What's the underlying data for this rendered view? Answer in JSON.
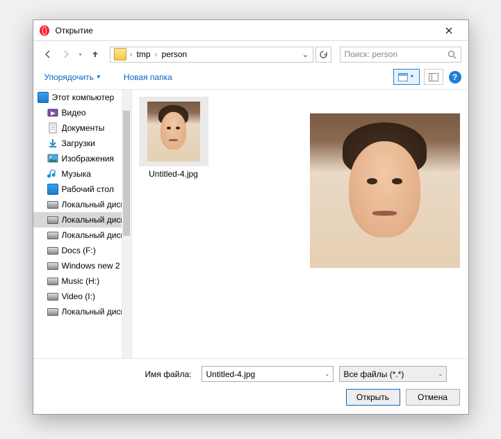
{
  "window": {
    "title": "Открытие"
  },
  "breadcrumb": {
    "seg1": "tmp",
    "seg2": "person"
  },
  "search": {
    "placeholder": "Поиск: person"
  },
  "toolbar": {
    "organize": "Упорядочить",
    "newfolder": "Новая папка"
  },
  "tree": {
    "root": "Этот компьютер",
    "items": [
      "Видео",
      "Документы",
      "Загрузки",
      "Изображения",
      "Музыка",
      "Рабочий стол",
      "Локальный диск",
      "Локальный диск",
      "Локальный диск",
      "Docs (F:)",
      "Windows new 2",
      "Music (H:)",
      "Video (I:)",
      "Локальный диск"
    ],
    "selected_index": 7
  },
  "files": {
    "item0": "Untitled-4.jpg"
  },
  "footer": {
    "filename_label": "Имя файла:",
    "filename_value": "Untitled-4.jpg",
    "filter": "Все файлы (*.*)",
    "open": "Открыть",
    "cancel": "Отмена"
  }
}
